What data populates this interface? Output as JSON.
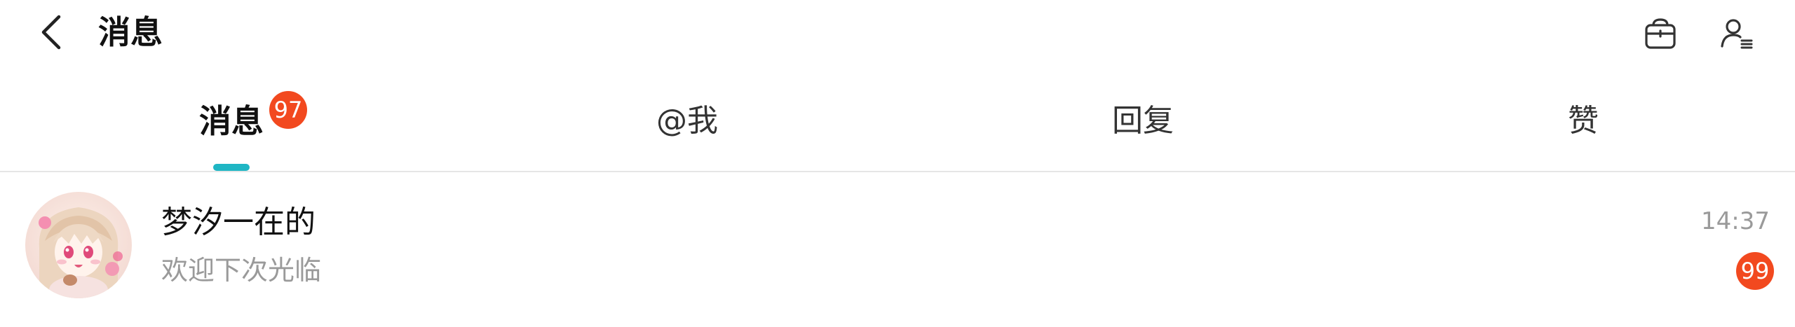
{
  "header": {
    "title": "消息",
    "back_icon": "chevron-left-icon",
    "shop_icon": "shop-basket-icon",
    "contacts_icon": "contacts-list-icon"
  },
  "tabs": [
    {
      "label": "消息",
      "active": true,
      "badge": "97"
    },
    {
      "label": "@我",
      "active": false
    },
    {
      "label": "回复",
      "active": false
    },
    {
      "label": "赞",
      "active": false
    }
  ],
  "conversations": [
    {
      "name": "梦汐一在的",
      "preview": "欢迎下次光临",
      "time": "14:37",
      "unread": "99"
    }
  ],
  "colors": {
    "accent": "#1fb6c4",
    "badge": "#f2491f",
    "secondary_text": "#9a9a9a"
  }
}
